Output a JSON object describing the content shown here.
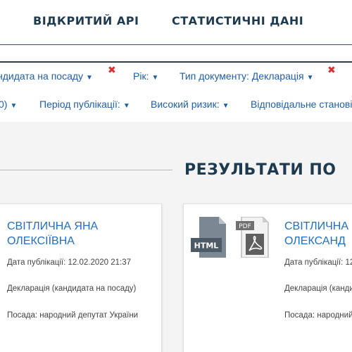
{
  "nav": {
    "api": "ВІДКРИТИЙ API",
    "stats": "СТАТИСТИЧНІ ДАНІ"
  },
  "filters": {
    "row1": [
      {
        "label": "ндидата на посаду"
      },
      {
        "label": "Рік:"
      },
      {
        "label": "Тип документу: Декларація"
      }
    ],
    "row2": [
      {
        "label": "0)"
      },
      {
        "label": "Період публікації:"
      },
      {
        "label": "Високий ризик:"
      },
      {
        "label": "Відповідальне станові"
      }
    ],
    "remove_symbol": "✖"
  },
  "results": {
    "title": "РЕЗУЛЬТАТИ ПО"
  },
  "cards": [
    {
      "name_line1": "Світлична Яна",
      "name_line2": "Олексіївна",
      "date": "Дата публікації: 12.02.2020 21:37",
      "type": "Декларація (кандидата на посаду)",
      "post": "Посада: народний депутат України"
    },
    {
      "name_line1": "Світлична",
      "name_line2": "Олександ",
      "date": "Дата публікації: 12",
      "type": "Декларація (канди",
      "post": "Посада: народний"
    }
  ],
  "icons": {
    "html_label": "HTML",
    "pdf_label": "PDF"
  },
  "colors": {
    "nav_text": "#1e3a4f",
    "filter_link": "#1f5ea8",
    "remove": "#d63030",
    "card_name": "#1f6fc4",
    "background": "#f4f4f4"
  }
}
